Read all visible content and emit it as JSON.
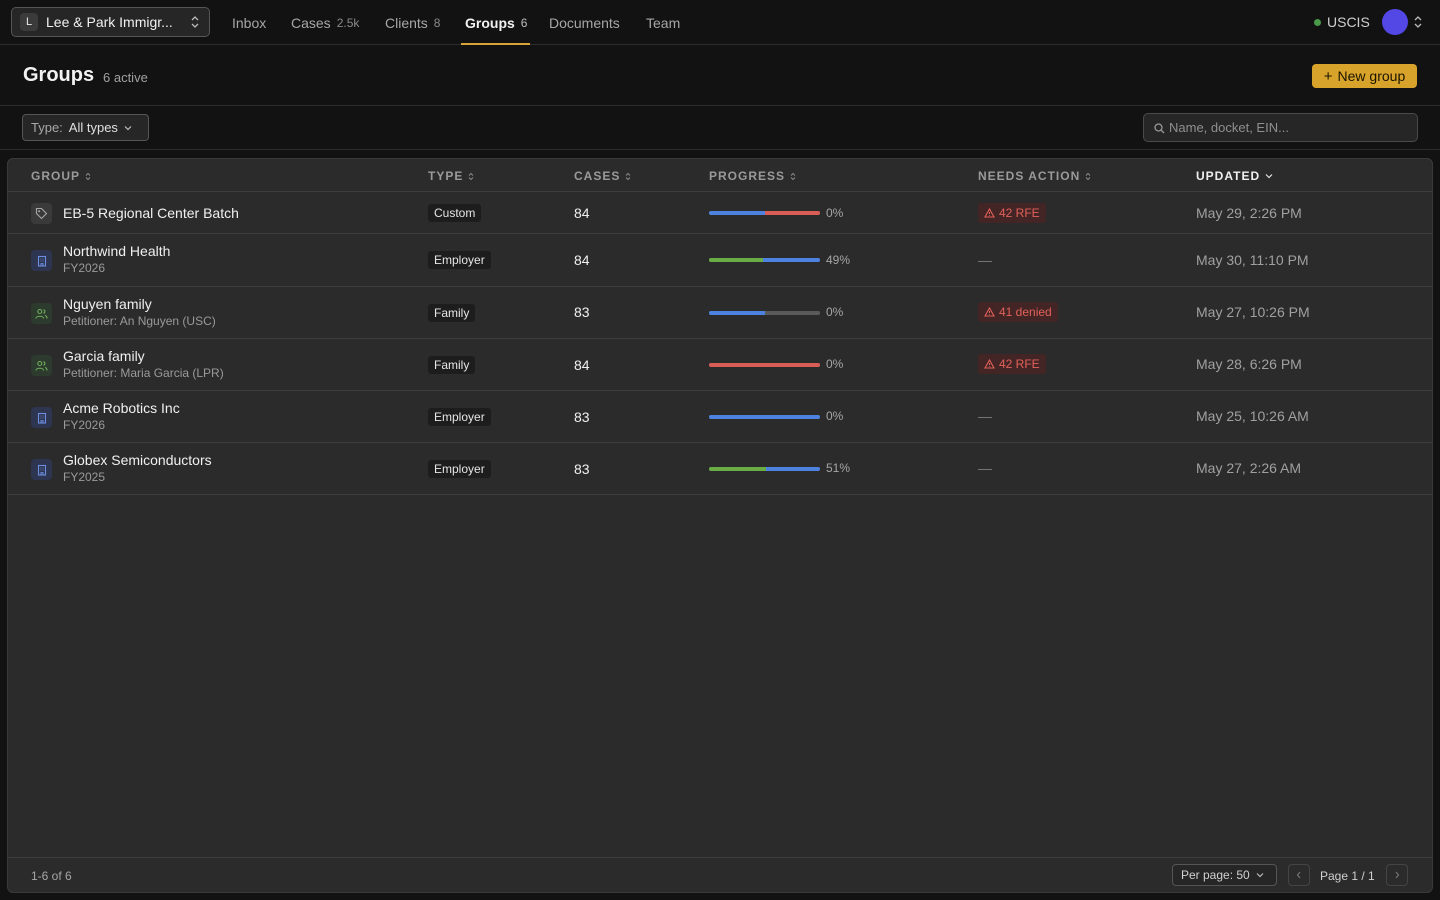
{
  "workspace": {
    "badge": "L",
    "name": "Lee & Park Immigr..."
  },
  "nav": [
    {
      "label": "Inbox",
      "count": ""
    },
    {
      "label": "Cases",
      "count": "2.5k"
    },
    {
      "label": "Clients",
      "count": "8"
    },
    {
      "label": "Groups",
      "count": "6",
      "active": true
    },
    {
      "label": "Documents",
      "count": ""
    },
    {
      "label": "Team",
      "count": ""
    }
  ],
  "status": {
    "label": "USCIS",
    "dot_color": "#4a9a4a"
  },
  "avatar_color": "#5347e6",
  "page": {
    "title": "Groups",
    "subtitle": "6 active",
    "new_button": "New group"
  },
  "filter": {
    "label": "Type:",
    "value": "All types"
  },
  "search": {
    "placeholder": "Name, docket, EIN..."
  },
  "columns": {
    "group": "GROUP",
    "type": "TYPE",
    "cases": "CASES",
    "progress": "PROGRESS",
    "needs_action": "NEEDS ACTION",
    "updated": "UPDATED"
  },
  "rows": [
    {
      "name": "EB-5 Regional Center Batch",
      "sub": "",
      "icon": "tag-icon",
      "type": "Custom",
      "cases": "84",
      "progress_pct": "0%",
      "progress_segments": [
        {
          "fraction": 0.5,
          "color": "#4d82e0"
        },
        {
          "fraction": 0.5,
          "color": "#d95d55"
        }
      ],
      "needs_action": "42 RFE",
      "updated": "May 29, 2:26 PM"
    },
    {
      "name": "Northwind Health",
      "sub": "FY2026",
      "icon": "building-icon",
      "type": "Employer",
      "cases": "84",
      "progress_pct": "49%",
      "progress_segments": [
        {
          "fraction": 0.49,
          "color": "#6aad45"
        },
        {
          "fraction": 0.51,
          "color": "#4d82e0"
        }
      ],
      "needs_action": "—",
      "updated": "May 30, 11:10 PM"
    },
    {
      "name": "Nguyen family",
      "sub": "Petitioner: An Nguyen (USC)",
      "icon": "family-icon",
      "type": "Family",
      "cases": "83",
      "progress_pct": "0%",
      "progress_segments": [
        {
          "fraction": 0.5,
          "color": "#4d82e0"
        },
        {
          "fraction": 0.5,
          "color": "#5a5a5a"
        }
      ],
      "needs_action": "41 denied",
      "updated": "May 27, 10:26 PM"
    },
    {
      "name": "Garcia family",
      "sub": "Petitioner: Maria Garcia (LPR)",
      "icon": "family-icon",
      "type": "Family",
      "cases": "84",
      "progress_pct": "0%",
      "progress_segments": [
        {
          "fraction": 1.0,
          "color": "#d95d55"
        }
      ],
      "needs_action": "42 RFE",
      "updated": "May 28, 6:26 PM"
    },
    {
      "name": "Acme Robotics Inc",
      "sub": "FY2026",
      "icon": "building-icon",
      "type": "Employer",
      "cases": "83",
      "progress_pct": "0%",
      "progress_segments": [
        {
          "fraction": 1.0,
          "color": "#4d82e0"
        }
      ],
      "needs_action": "—",
      "updated": "May 25, 10:26 AM"
    },
    {
      "name": "Globex Semiconductors",
      "sub": "FY2025",
      "icon": "building-icon",
      "type": "Employer",
      "cases": "83",
      "progress_pct": "51%",
      "progress_segments": [
        {
          "fraction": 0.51,
          "color": "#6aad45"
        },
        {
          "fraction": 0.49,
          "color": "#4d82e0"
        }
      ],
      "needs_action": "—",
      "updated": "May 27, 2:26 AM"
    }
  ],
  "footer": {
    "range": "1-6 of 6",
    "per_page": "Per page: 50",
    "page": "Page 1 / 1"
  }
}
